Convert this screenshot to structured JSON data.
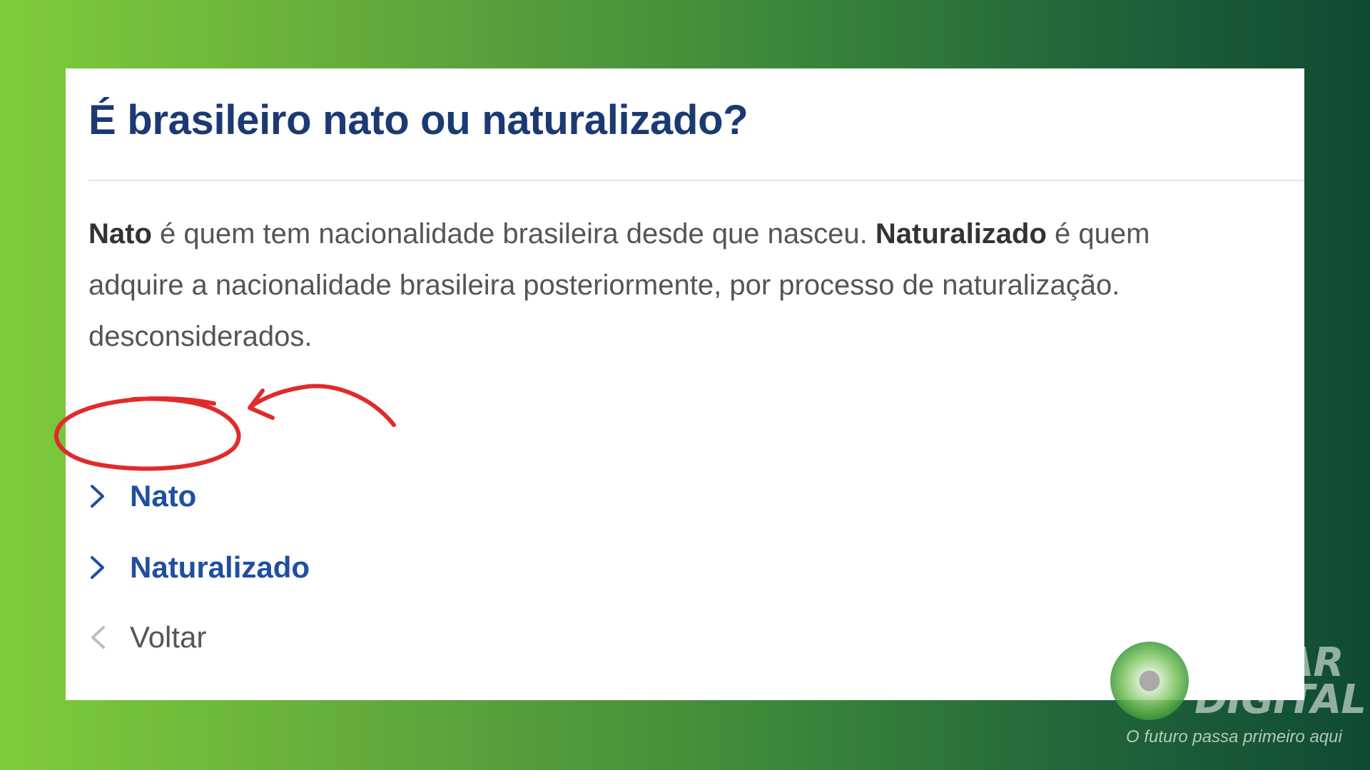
{
  "question": {
    "title": "É brasileiro nato ou naturalizado?"
  },
  "description": {
    "term1": "Nato",
    "text1": " é quem tem nacionalidade brasileira desde que nasceu. ",
    "term2": "Naturalizado",
    "text2": " é quem adquire a nacionalidade brasileira posteriormente, por processo de naturalização. desconsiderados."
  },
  "options": [
    {
      "label": "Nato",
      "icon": "chevron-right-icon"
    },
    {
      "label": "Naturalizado",
      "icon": "chevron-right-icon"
    }
  ],
  "back": {
    "label": "Voltar",
    "icon": "chevron-left-icon"
  },
  "annotation": {
    "color": "#e02b2b"
  },
  "watermark": {
    "line1": "DIWAR",
    "line2": "DIGITAL",
    "slogan": "O futuro passa primeiro aqui"
  },
  "colors": {
    "title": "#1b3a73",
    "link": "#1f4fa0",
    "body_text": "#555555"
  }
}
